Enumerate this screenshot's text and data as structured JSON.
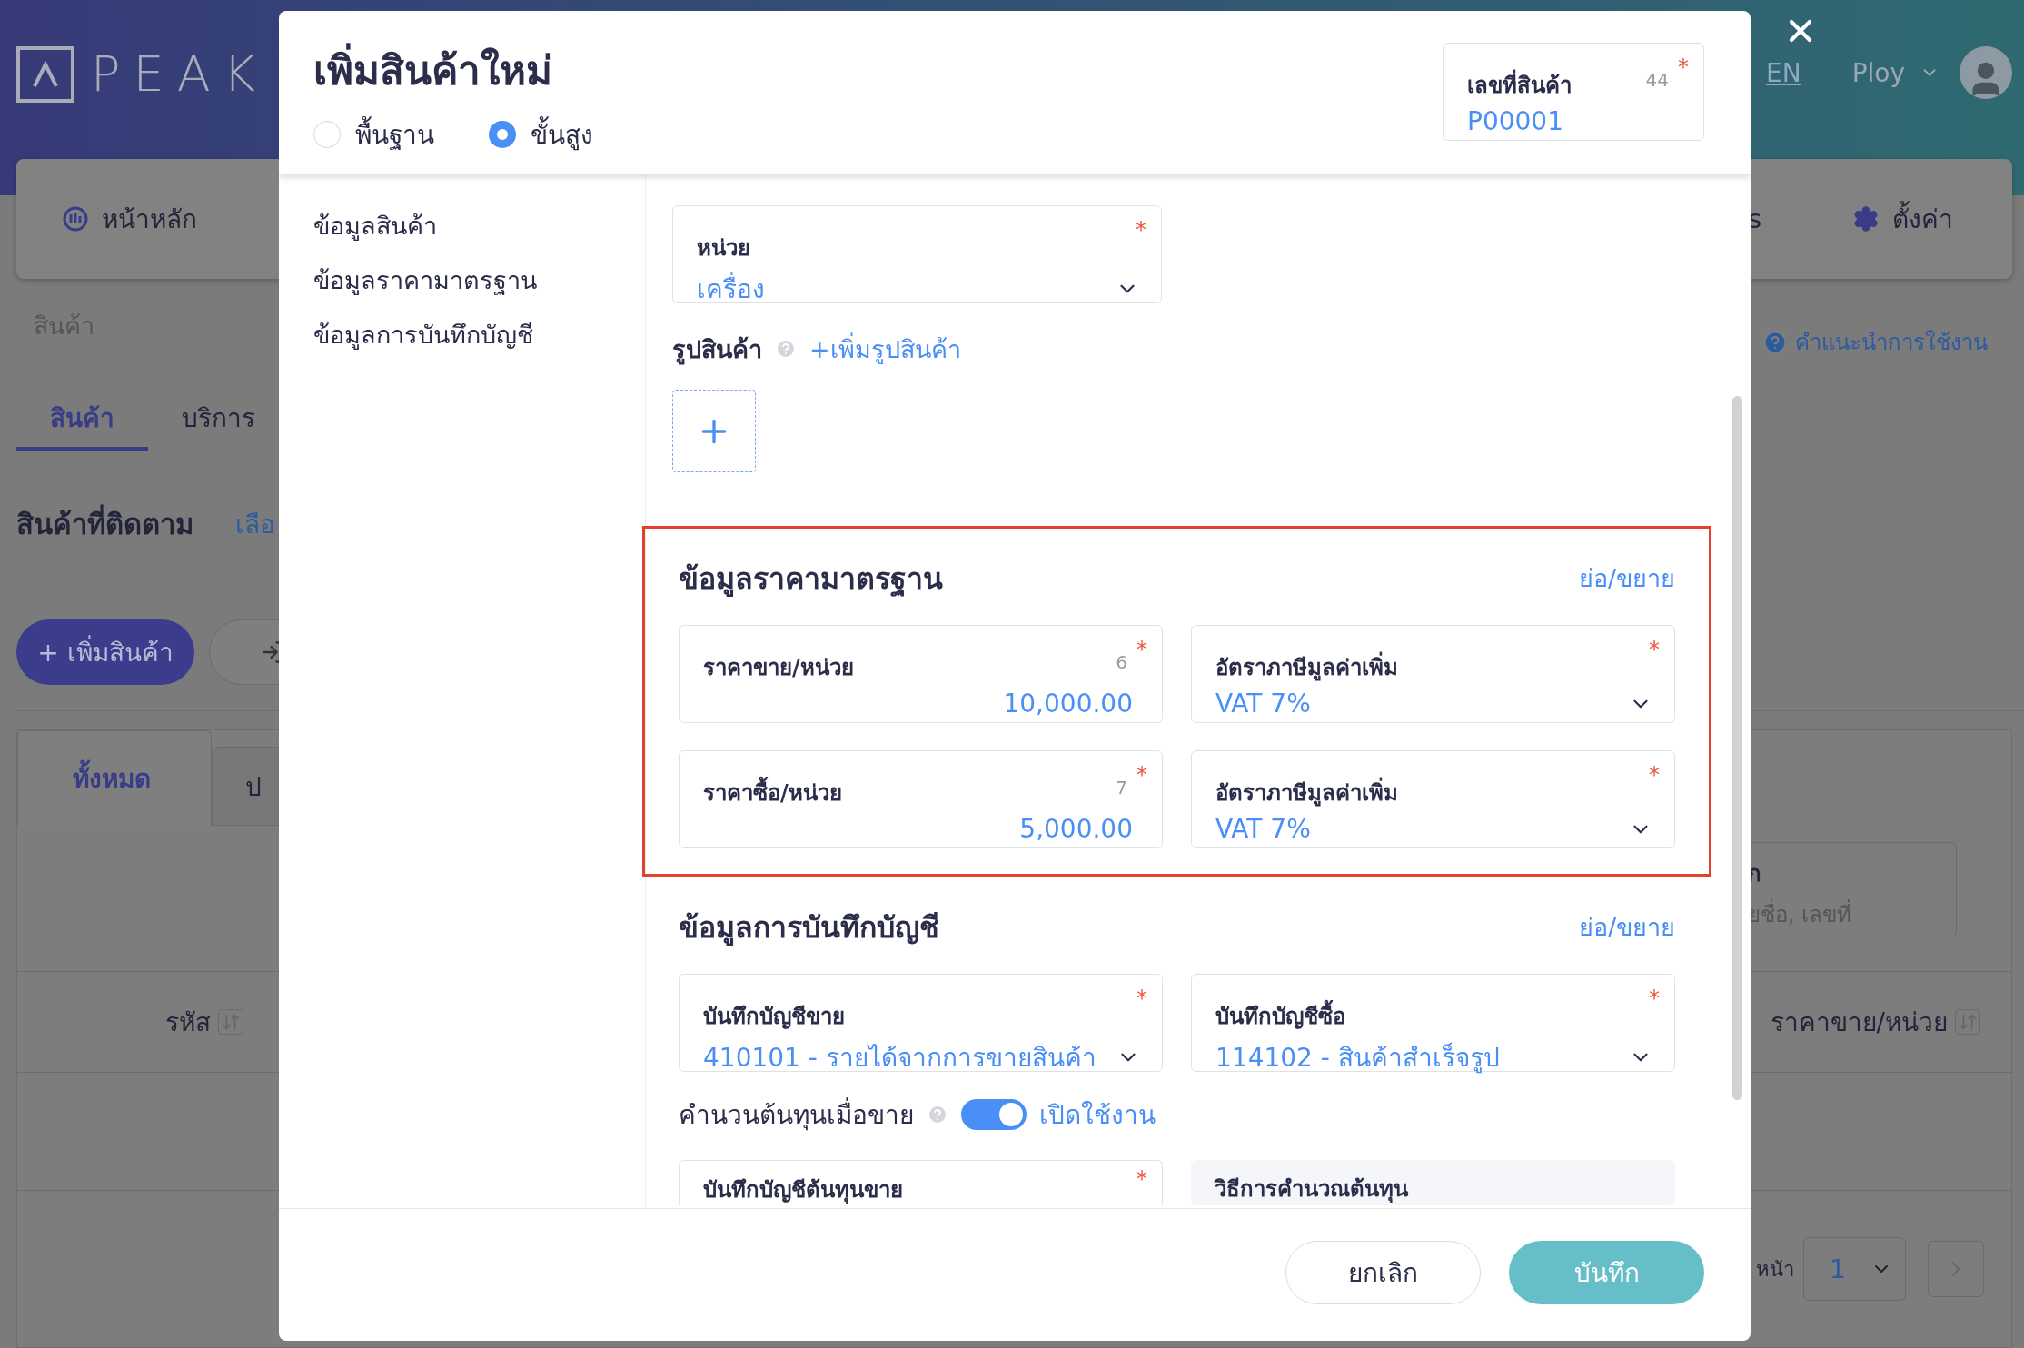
{
  "background": {
    "logo": "PEAK",
    "language": "EN",
    "user": "Ploy",
    "nav_left": [
      {
        "label": "หน้าหลัก"
      }
    ],
    "nav_right": [
      {
        "label": "s"
      },
      {
        "label": "ตั้งค่า"
      }
    ],
    "breadcrumb": "สินค้า",
    "help_link": "คำแนะนำการใช้งาน",
    "type_tabs": [
      {
        "label": "สินค้า",
        "selected": true
      },
      {
        "label": "บริการ",
        "selected": false
      }
    ],
    "watch_title": "สินค้าที่ติดตาม",
    "watch_link": "เลือ",
    "add_button": "+ เพิ่มสินค้า",
    "status_tabs": [
      {
        "label": "ทั้งหมด",
        "selected": true
      },
      {
        "label": "ป",
        "selected": false
      }
    ],
    "search": {
      "label": "ก",
      "placeholder": "ยชื่อ, เลขที่"
    },
    "columns": [
      "รหัส",
      "ราคาขาย/หน่วย"
    ],
    "pagination": {
      "label": "หน้า",
      "page": "1"
    }
  },
  "modal": {
    "title": "เพิ่มสินค้าใหม่",
    "modes": [
      {
        "label": "พื้นฐาน",
        "selected": false
      },
      {
        "label": "ขั้นสูง",
        "selected": true
      }
    ],
    "code_field": {
      "label": "เลขที่สินค้า",
      "counter": "44",
      "required_mark": "*",
      "value": "P00001"
    },
    "nav": [
      "ข้อมูลสินค้า",
      "ข้อมูลราคามาตรฐาน",
      "ข้อมูลการบันทึกบัญชี"
    ],
    "unit_field": {
      "kind": "select",
      "label": "หน่วย",
      "required_mark": "*",
      "value": "เครื่อง"
    },
    "image": {
      "label": "รูปสินค้า",
      "add_link": "+เพิ่มรูปสินค้า"
    },
    "sections": [
      {
        "title": "ข้อมูลราคามาตรฐาน",
        "toggle_link": "ย่อ/ขยาย",
        "highlighted": true,
        "fields": [
          {
            "kind": "input",
            "label": "ราคาขาย/หน่วย",
            "counter": "6",
            "required_mark": "*",
            "value": "10,000.00"
          },
          {
            "kind": "select",
            "label": "อัตราภาษีมูลค่าเพิ่ม",
            "required_mark": "*",
            "value": "VAT 7%"
          },
          {
            "kind": "input",
            "label": "ราคาซื้อ/หน่วย",
            "counter": "7",
            "required_mark": "*",
            "value": "5,000.00"
          },
          {
            "kind": "select",
            "label": "อัตราภาษีมูลค่าเพิ่ม",
            "required_mark": "*",
            "value": "VAT 7%"
          }
        ]
      },
      {
        "title": "ข้อมูลการบันทึกบัญชี",
        "toggle_link": "ย่อ/ขยาย",
        "highlighted": false,
        "fields": [
          {
            "kind": "select",
            "label": "บันทึกบัญชีขาย",
            "required_mark": "*",
            "value": "410101 - รายได้จากการขายสินค้า"
          },
          {
            "kind": "select",
            "label": "บันทึกบัญชีซื้อ",
            "required_mark": "*",
            "value": "114102 - สินค้าสำเร็จรูป"
          }
        ],
        "switch": {
          "label": "คำนวนต้นทุนเมื่อขาย",
          "on": true,
          "text": "เปิดใช้งาน"
        },
        "more_fields": [
          {
            "kind": "partial",
            "label": "บันทึกบัญชีต้นทุนขาย",
            "required_mark": "*"
          },
          {
            "kind": "readonly",
            "label": "วิธีการคำนวณต้นทุน"
          }
        ]
      }
    ],
    "buttons": [
      {
        "kind": "secondary",
        "label": "ยกเลิก"
      },
      {
        "kind": "primary",
        "label": "บันทึก"
      }
    ]
  }
}
